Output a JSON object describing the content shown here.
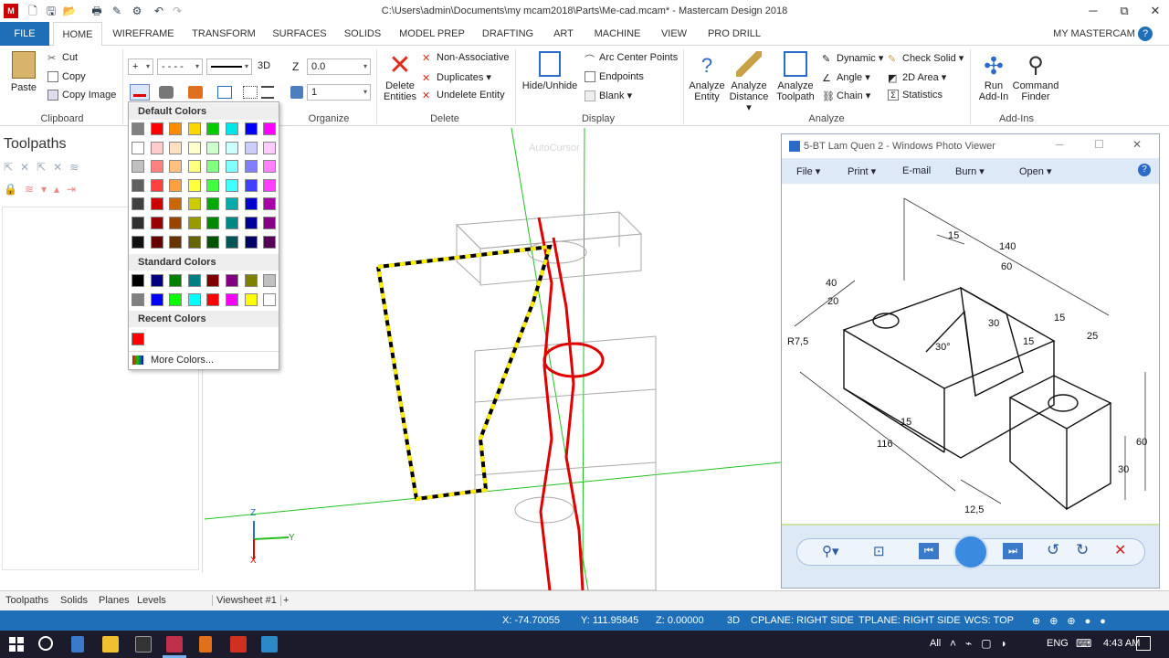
{
  "window": {
    "title": "C:\\Users\\admin\\Documents\\my mcam2018\\Parts\\Me-cad.mcam* - Mastercam Design 2018",
    "controls": [
      "─",
      "⧉",
      "✕"
    ]
  },
  "tabs": [
    "FILE",
    "HOME",
    "WIREFRAME",
    "TRANSFORM",
    "SURFACES",
    "SOLIDS",
    "MODEL PREP",
    "DRAFTING",
    "ART",
    "MACHINE",
    "VIEW",
    "PRO DRILL"
  ],
  "my_mastercam": "MY MASTERCAM",
  "ribbon": {
    "clipboard": {
      "paste": "Paste",
      "cut": "Cut",
      "copy": "Copy",
      "copy_image": "Copy Image",
      "label": "Clipboard"
    },
    "attributes": {
      "mode": "3D"
    },
    "organize": {
      "z_label": "Z",
      "z_value": "0.0",
      "level_value": "1",
      "label": "Organize"
    },
    "delete": {
      "delete_entities": "Delete Entities",
      "non_associative": "Non-Associative",
      "duplicates": "Duplicates",
      "undelete": "Undelete Entity",
      "label": "Delete"
    },
    "display": {
      "hide_unhide": "Hide/Unhide",
      "arc_center_points": "Arc Center Points",
      "endpoints": "Endpoints",
      "blank": "Blank",
      "label": "Display"
    },
    "analyze": {
      "analyze_entity": "Analyze Entity",
      "analyze_distance": "Analyze Distance",
      "analyze_toolpath": "Analyze Toolpath",
      "dynamic": "Dynamic",
      "angle": "Angle",
      "chain": "Chain",
      "check_solid": "Check Solid",
      "area_2d": "2D Area",
      "statistics": "Statistics",
      "label": "Analyze"
    },
    "addins": {
      "run_addin": "Run Add-In",
      "command_finder": "Command Finder",
      "label": "Add-Ins"
    }
  },
  "color_panel": {
    "default_header": "Default Colors",
    "standard_header": "Standard Colors",
    "recent_header": "Recent Colors",
    "more_colors": "More Colors...",
    "default_rows": [
      [
        "#808080",
        "#ff0000",
        "#ff8c00",
        "#ffd700",
        "#00cc00",
        "#00e5e5",
        "#0000ff",
        "#ff00ff"
      ],
      [
        "#ffffff",
        "#ffcccc",
        "#ffe0c0",
        "#ffffcc",
        "#ccffcc",
        "#ccffff",
        "#ccccff",
        "#ffccff"
      ],
      [
        "#c0c0c0",
        "#ff8080",
        "#ffc080",
        "#ffff80",
        "#80ff80",
        "#80ffff",
        "#8080ff",
        "#ff80ff"
      ],
      [
        "#606060",
        "#ff4040",
        "#ffa040",
        "#ffff40",
        "#40ff40",
        "#40ffff",
        "#4040ff",
        "#ff40ff"
      ],
      [
        "#404040",
        "#cc0000",
        "#cc6600",
        "#cccc00",
        "#00aa00",
        "#00aaaa",
        "#0000cc",
        "#aa00aa"
      ],
      [
        "#303030",
        "#990000",
        "#994400",
        "#999900",
        "#008800",
        "#008888",
        "#000099",
        "#880088"
      ],
      [
        "#101010",
        "#660000",
        "#663300",
        "#666600",
        "#005500",
        "#005555",
        "#000066",
        "#550055"
      ]
    ],
    "standard_rows": [
      [
        "#000000",
        "#000080",
        "#008000",
        "#008080",
        "#800000",
        "#800080",
        "#808000",
        "#c0c0c0"
      ],
      [
        "#808080",
        "#0000ff",
        "#00ff00",
        "#00ffff",
        "#ff0000",
        "#ff00ff",
        "#ffff00",
        "#ffffff"
      ]
    ],
    "recent": [
      "#ff0000"
    ]
  },
  "left_panel": {
    "title": "Toolpaths"
  },
  "viewport": {
    "watermark": "AutoCursor",
    "axis_z": "Z",
    "axis_y": "Y",
    "axis_x": "X"
  },
  "bottom_tabs": [
    "Toolpaths",
    "Solids",
    "Planes",
    "Levels"
  ],
  "viewsheet": "Viewsheet #1",
  "status": {
    "x": "X:  -74.70055",
    "y": "Y:  111.95845",
    "z": "Z:  0.00000",
    "mode": "3D",
    "cplane": "CPLANE: RIGHT SIDE",
    "tplane": "TPLANE: RIGHT SIDE",
    "wcs": "WCS: TOP"
  },
  "photo_viewer": {
    "title": "5-BT Lam Quen 2 - Windows Photo Viewer",
    "menu": [
      "File",
      "Print",
      "E-mail",
      "Burn",
      "Open"
    ],
    "dims": [
      "15",
      "140",
      "60",
      "40",
      "20",
      "R7,5",
      "30°",
      "30",
      "15",
      "15",
      "25",
      "15",
      "116",
      "12,5",
      "30",
      "60"
    ]
  },
  "taskbar": {
    "lang": "ENG",
    "time": "4:43 AM",
    "all": "All"
  },
  "colors": {
    "accent": "#1e6fb8",
    "wire": "#e00000",
    "dash_yellow": "#ffee00"
  }
}
